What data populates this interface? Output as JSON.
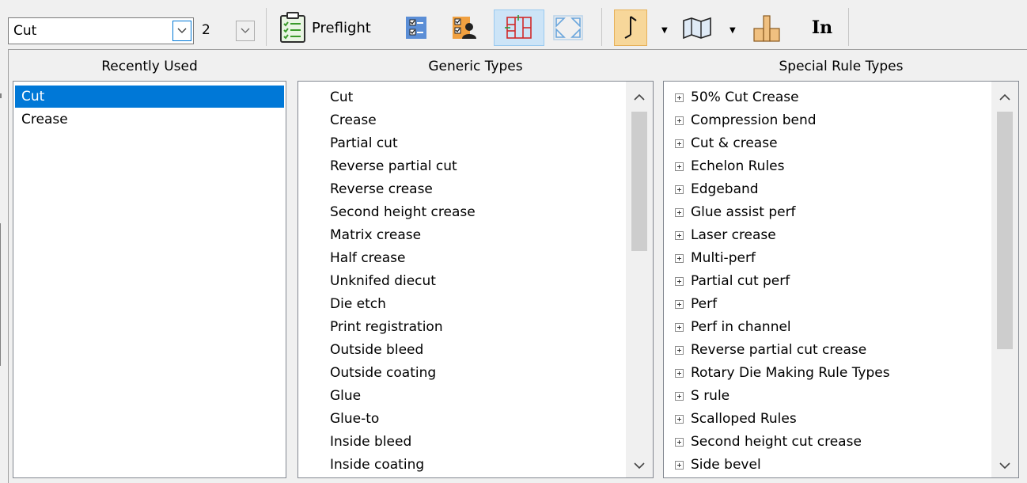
{
  "toolbar": {
    "rule_type_value": "Cut",
    "pen_number": "2",
    "preflight_label": "Preflight",
    "in_label": "In"
  },
  "recently_used": {
    "header": "Recently Used",
    "items": [
      "Cut",
      "Crease"
    ],
    "selected_index": 0
  },
  "generic_types": {
    "header": "Generic Types",
    "items": [
      "Cut",
      "Crease",
      "Partial cut",
      "Reverse partial cut",
      "Reverse crease",
      "Second height crease",
      "Matrix crease",
      "Half crease",
      "Unknifed diecut",
      "Die etch",
      "Print registration",
      "Outside bleed",
      "Outside coating",
      "Glue",
      "Glue-to",
      "Inside bleed",
      "Inside coating"
    ]
  },
  "special_rule_types": {
    "header": "Special Rule Types",
    "items": [
      "50% Cut Crease",
      "Compression bend",
      "Cut & crease",
      "Echelon Rules",
      "Edgeband",
      "Glue assist perf",
      "Laser crease",
      "Multi-perf",
      "Partial cut perf",
      "Perf",
      "Perf in channel",
      "Reverse partial cut crease",
      "Rotary Die Making Rule Types",
      "S rule",
      "Scalloped Rules",
      "Second height cut crease",
      "Side bevel"
    ]
  },
  "colors": {
    "selection": "#0078d7",
    "hot_button": "#f7d79a",
    "pressed_button": "#cce4f7"
  }
}
